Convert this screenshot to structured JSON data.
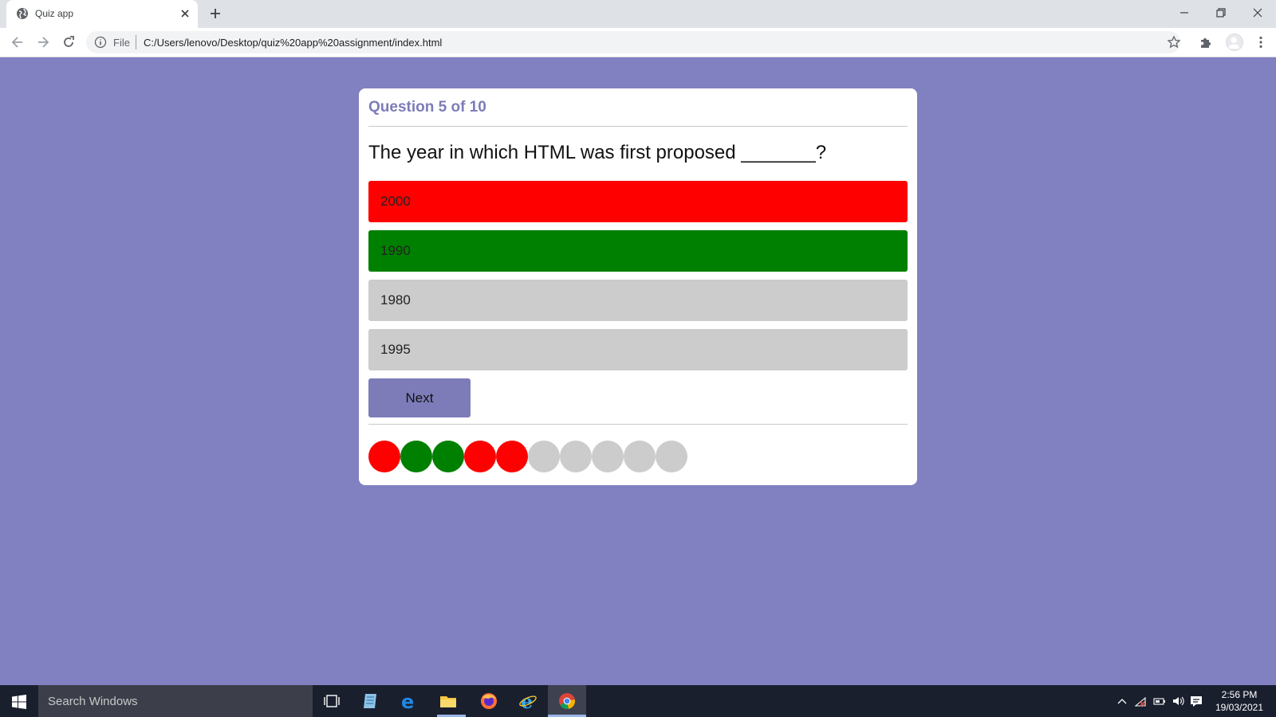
{
  "browser": {
    "tab_title": "Quiz app",
    "address_scheme": "File",
    "url": "C:/Users/lenovo/Desktop/quiz%20app%20assignment/index.html"
  },
  "quiz": {
    "counter": "Question 5 of 10",
    "question": "The year in which HTML was first proposed _______?",
    "options": [
      {
        "label": "2000",
        "state": "wrong",
        "color": "#ff0000"
      },
      {
        "label": "1990",
        "state": "correct",
        "color": "#008000"
      },
      {
        "label": "1980",
        "state": "neutral",
        "color": "#cccccc"
      },
      {
        "label": "1995",
        "state": "neutral",
        "color": "#cccccc"
      }
    ],
    "next_label": "Next",
    "progress": [
      "wrong",
      "correct",
      "correct",
      "wrong",
      "wrong",
      "pending",
      "pending",
      "pending",
      "pending",
      "pending"
    ],
    "progress_colors": {
      "wrong": "#ff0000",
      "correct": "#008000",
      "pending": "#cccccc"
    },
    "accent_color": "#7d7cb9",
    "background_color": "#8180c1"
  },
  "taskbar": {
    "search_placeholder": "Search Windows",
    "time": "2:56 PM",
    "date": "19/03/2021",
    "apps": [
      "task-view-icon",
      "notepad-icon",
      "edge-icon",
      "file-explorer-icon",
      "firefox-icon",
      "internet-explorer-icon",
      "chrome-icon"
    ]
  }
}
